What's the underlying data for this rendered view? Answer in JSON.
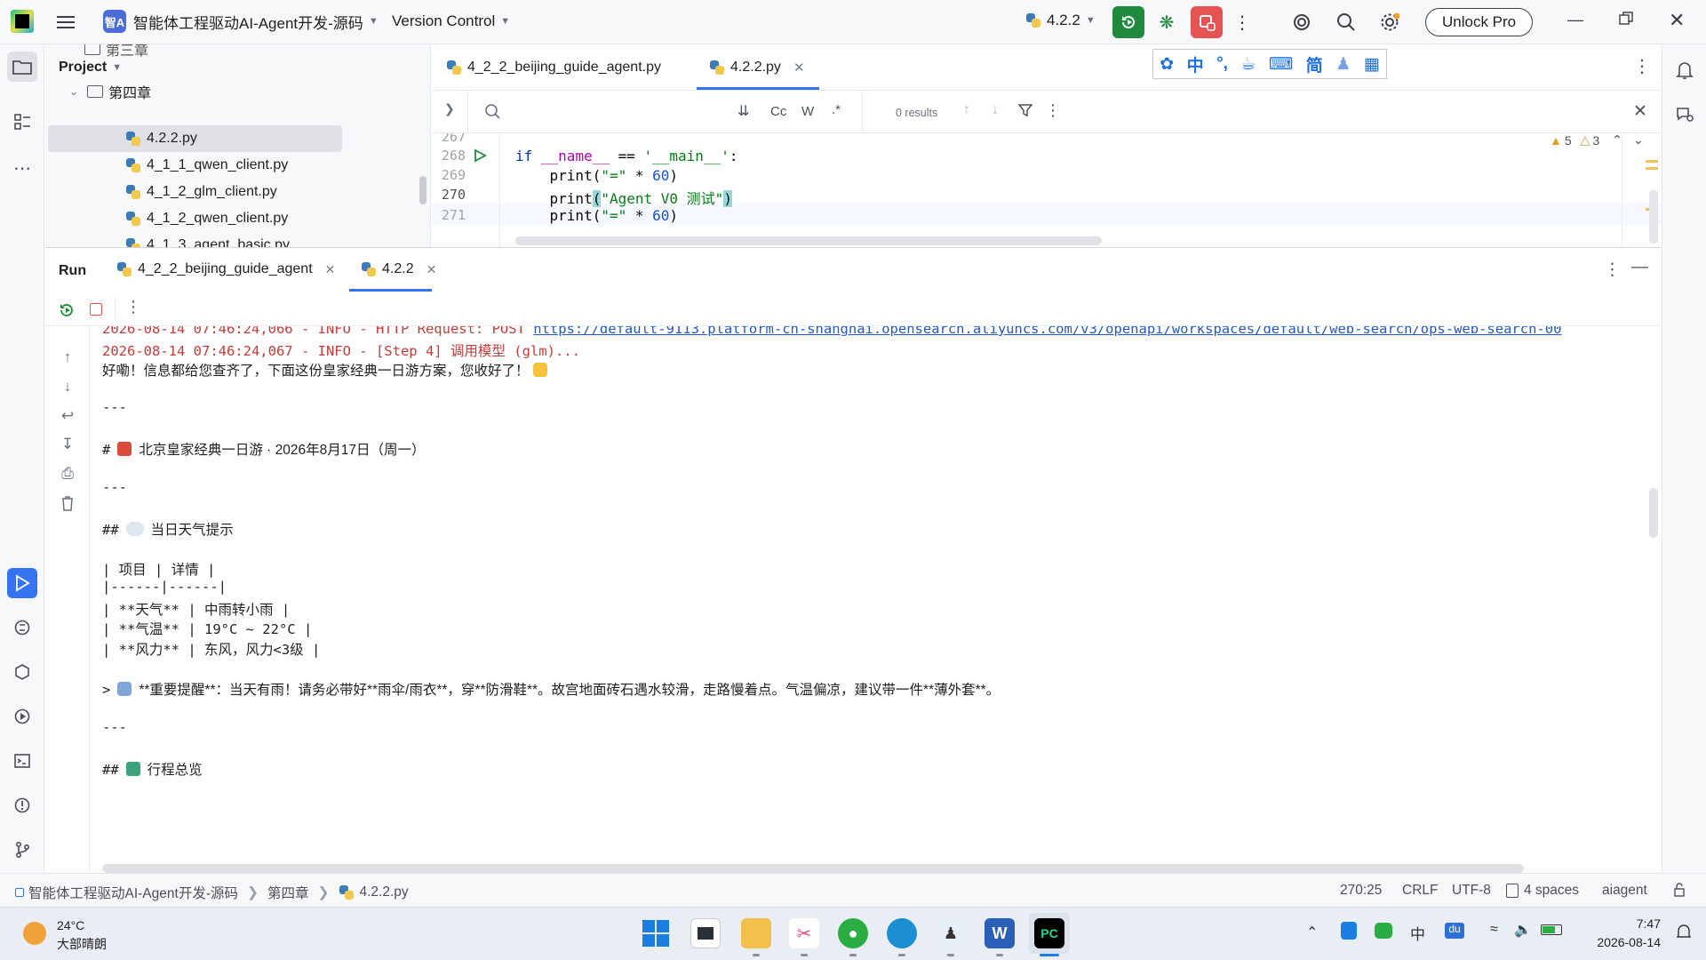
{
  "titlebar": {
    "project_badge": "智A",
    "project_name": "智能体工程驱动AI-Agent开发-源码",
    "vcs": "Version Control",
    "run_config": "4.2.2",
    "unlock": "Unlock Pro"
  },
  "project_panel": {
    "title": "Project",
    "rows": [
      {
        "label": "第三章",
        "kind": "folder-partial"
      },
      {
        "label": "第四章",
        "kind": "folder"
      },
      {
        "label": "4.2.2.py",
        "kind": "py",
        "selected": true
      },
      {
        "label": "4_1_1_qwen_client.py",
        "kind": "py"
      },
      {
        "label": "4_1_2_glm_client.py",
        "kind": "py"
      },
      {
        "label": "4_1_2_qwen_client.py",
        "kind": "py"
      },
      {
        "label": "4_1_3_agent_basic.py",
        "kind": "py-partial"
      }
    ]
  },
  "editor": {
    "tabs": [
      {
        "label": "4_2_2_beijing_guide_agent.py",
        "active": false
      },
      {
        "label": "4.2.2.py",
        "active": true
      }
    ],
    "find": {
      "results": "0 results",
      "opt_case": "Cc",
      "opt_word": "W",
      "opt_regex": ".*"
    },
    "inspections": {
      "warnings": "5",
      "weak": "3"
    },
    "lines": [
      {
        "num": "267",
        "text": ""
      },
      {
        "num": "268",
        "text": "if __name__ == '__main__':"
      },
      {
        "num": "269",
        "text": "    print(\"=\" * 60)"
      },
      {
        "num": "270",
        "text": "    print(\"Agent V0 测试\")"
      },
      {
        "num": "271",
        "text": "    print(\"=\" * 60)"
      }
    ]
  },
  "ime": {
    "items": [
      "paw-icon",
      "中",
      "punct-icon",
      "cup-icon",
      "keyboard-icon",
      "简",
      "user-icon",
      "grid-icon"
    ]
  },
  "run_panel": {
    "title": "Run",
    "tabs": [
      {
        "label": "4_2_2_beijing_guide_agent",
        "active": false
      },
      {
        "label": "4.2.2",
        "active": true
      }
    ],
    "console": {
      "line0": "2026-08-14 07:46:24,066 - INFO - HTTP Request: POST ",
      "line0_link": "https://default-9113.platform-cn-shanghai.opensearch.aliyuncs.com/v3/openapi/workspaces/default/web-search/ops-web-search-00",
      "line1": "2026-08-14 07:46:24,067 - INFO - [Step 4] 调用模型 (glm)...",
      "line2": "好嘞！信息都给您查齐了，下面这份皇家经典一日游方案，您收好了！",
      "hr1": "---",
      "h1_prefix": "#",
      "h1_text": "北京皇家经典一日游 · 2026年8月17日（周一）",
      "hr2": "---",
      "h2_prefix": "##",
      "h2_text": "当日天气提示",
      "table": [
        "| 项目 | 详情 |",
        "|------|------|",
        "| **天气** | 中雨转小雨 |",
        "| **气温** | 19°C ~ 22°C |",
        "| **风力** | 东风，风力<3级 |"
      ],
      "quote_prefix": ">",
      "quote_text": "**重要提醒**：当天有雨！请务必带好**雨伞/雨衣**，穿**防滑鞋**。故宫地面砖石遇水较滑，走路慢着点。气温偏凉，建议带一件**薄外套**。",
      "hr3": "---",
      "h2b_prefix": "##",
      "h2b_text": "行程总览"
    }
  },
  "statusbar": {
    "breadcrumb": [
      "智能体工程驱动AI-Agent开发-源码",
      "第四章",
      "4.2.2.py"
    ],
    "position": "270:25",
    "line_sep": "CRLF",
    "encoding": "UTF-8",
    "indent": "4 spaces",
    "interpreter": "aiagent"
  },
  "taskbar": {
    "weather_temp": "24°C",
    "weather_desc": "大部晴朗",
    "ime_lang": "中",
    "time": "7:47",
    "date": "2026-08-14"
  },
  "colors": {
    "accent": "#3574f0",
    "run_green": "#208a3c",
    "stop_red": "#e55353",
    "log_red": "#c73b3b",
    "link": "#2458c5"
  }
}
